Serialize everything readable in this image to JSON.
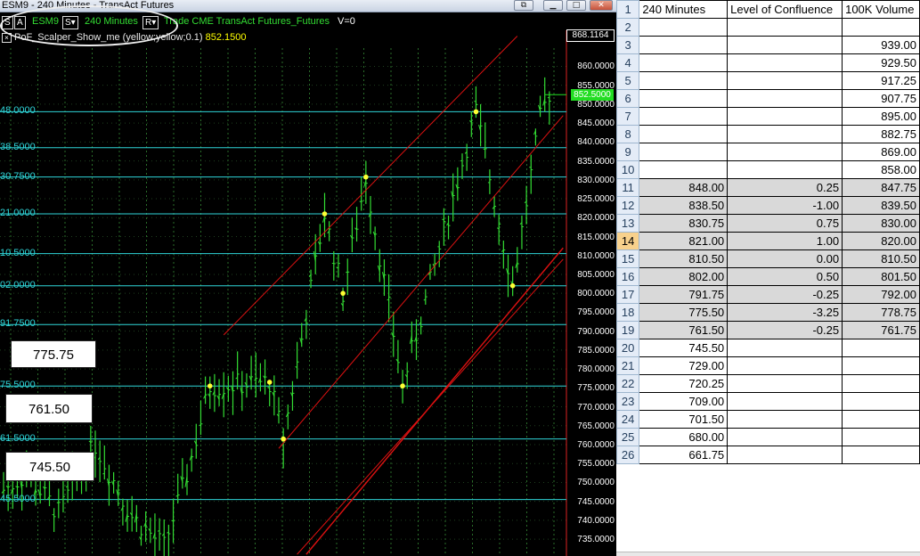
{
  "window": {
    "title": "ESM9 - 240 Minutes - TransAct Futures",
    "buttons": {
      "restore": "⧉",
      "minimize": "▁",
      "maximize": "□",
      "close": "✕"
    }
  },
  "toolbar": {
    "s_box": "S",
    "a_box": "A",
    "symbol": "ESM9",
    "s_dropdown": "S▾",
    "interval": "240 Minutes",
    "r_dropdown": "R▾",
    "info": "Trade CME TransAct Futures_Futures",
    "volume": "V=0"
  },
  "study": {
    "icon": "×",
    "label": "PoF_Scalper_Show_me (yellow;yellow;0.1)",
    "value": "852.1500"
  },
  "price_axis": {
    "top_box": "868.1164",
    "current_box": "852.5000",
    "labels": [
      "860.0000",
      "855.0000",
      "850.0000",
      "845.0000",
      "840.0000",
      "835.0000",
      "830.0000",
      "825.0000",
      "820.0000",
      "815.0000",
      "810.0000",
      "805.0000",
      "800.0000",
      "795.0000",
      "790.0000",
      "785.0000",
      "780.0000",
      "775.0000",
      "770.0000",
      "765.0000",
      "760.0000",
      "755.0000",
      "750.0000",
      "745.0000",
      "740.0000",
      "735.0000"
    ]
  },
  "levels": [
    {
      "label": "48.0000",
      "price": 848.0
    },
    {
      "label": "38.5000",
      "price": 838.5
    },
    {
      "label": "30.7500",
      "price": 830.75
    },
    {
      "label": "21.0000",
      "price": 821.0
    },
    {
      "label": "10.5000",
      "price": 810.5
    },
    {
      "label": "02.0000",
      "price": 802.0
    },
    {
      "label": "91.7500",
      "price": 791.75
    },
    {
      "label": "75.5000",
      "price": 775.5
    },
    {
      "label": "61.5000",
      "price": 761.5
    },
    {
      "label": "45.5000",
      "price": 745.5
    }
  ],
  "callouts": [
    "775.75",
    "761.50",
    "745.50"
  ],
  "colors": {
    "background": "#000000",
    "bars": "#33dd33",
    "levels": "#2fd5d8",
    "channels": "#dd1111",
    "grid": "#2a6e2a",
    "pivots": "#ffff33",
    "current_price": "#22dd22"
  },
  "chart_data": {
    "type": "bar",
    "y_range": [
      731.5,
      868.1164
    ],
    "current_price": 852.5,
    "pivots": [
      {
        "bar": 45,
        "price": 775.5
      },
      {
        "bar": 58,
        "price": 776.5
      },
      {
        "bar": 61,
        "price": 761.5
      },
      {
        "bar": 70,
        "price": 821.0
      },
      {
        "bar": 74,
        "price": 800.0
      },
      {
        "bar": 79,
        "price": 830.75
      },
      {
        "bar": 87,
        "price": 775.5
      },
      {
        "bar": 103,
        "price": 848.0
      },
      {
        "bar": 111,
        "price": 802.0
      }
    ]
  },
  "sheet": {
    "headers": [
      "240 Minutes",
      "Level of Confluence",
      "100K Volume"
    ],
    "active_row": 14,
    "rows": [
      {
        "n": "2",
        "a": "",
        "b": "",
        "c": "",
        "gray": false,
        "bord": true
      },
      {
        "n": "3",
        "a": "",
        "b": "",
        "c": "939.00",
        "gray": false,
        "bord": true
      },
      {
        "n": "4",
        "a": "",
        "b": "",
        "c": "929.50",
        "gray": false,
        "bord": true
      },
      {
        "n": "5",
        "a": "",
        "b": "",
        "c": "917.25",
        "gray": false,
        "bord": true
      },
      {
        "n": "6",
        "a": "",
        "b": "",
        "c": "907.75",
        "gray": false,
        "bord": true
      },
      {
        "n": "7",
        "a": "",
        "b": "",
        "c": "895.00",
        "gray": false,
        "bord": true
      },
      {
        "n": "8",
        "a": "",
        "b": "",
        "c": "882.75",
        "gray": false,
        "bord": true
      },
      {
        "n": "9",
        "a": "",
        "b": "",
        "c": "869.00",
        "gray": false,
        "bord": true
      },
      {
        "n": "10",
        "a": "",
        "b": "",
        "c": "858.00",
        "gray": false,
        "bord": true
      },
      {
        "n": "11",
        "a": "848.00",
        "b": "0.25",
        "c": "847.75",
        "gray": true,
        "bord": true
      },
      {
        "n": "12",
        "a": "838.50",
        "b": "-1.00",
        "c": "839.50",
        "gray": true,
        "bord": true
      },
      {
        "n": "13",
        "a": "830.75",
        "b": "0.75",
        "c": "830.00",
        "gray": true,
        "bord": true
      },
      {
        "n": "14",
        "a": "821.00",
        "b": "1.00",
        "c": "820.00",
        "gray": true,
        "bord": true
      },
      {
        "n": "15",
        "a": "810.50",
        "b": "0.00",
        "c": "810.50",
        "gray": true,
        "bord": true
      },
      {
        "n": "16",
        "a": "802.00",
        "b": "0.50",
        "c": "801.50",
        "gray": true,
        "bord": true
      },
      {
        "n": "17",
        "a": "791.75",
        "b": "-0.25",
        "c": "792.00",
        "gray": true,
        "bord": true
      },
      {
        "n": "18",
        "a": "775.50",
        "b": "-3.25",
        "c": "778.75",
        "gray": true,
        "bord": true
      },
      {
        "n": "19",
        "a": "761.50",
        "b": "-0.25",
        "c": "761.75",
        "gray": true,
        "bord": true
      },
      {
        "n": "20",
        "a": "745.50",
        "b": "",
        "c": "",
        "gray": false,
        "bord": true
      },
      {
        "n": "21",
        "a": "729.00",
        "b": "",
        "c": "",
        "gray": false,
        "bord": true
      },
      {
        "n": "22",
        "a": "720.25",
        "b": "",
        "c": "",
        "gray": false,
        "bord": true
      },
      {
        "n": "23",
        "a": "709.00",
        "b": "",
        "c": "",
        "gray": false,
        "bord": true
      },
      {
        "n": "24",
        "a": "701.50",
        "b": "",
        "c": "",
        "gray": false,
        "bord": true
      },
      {
        "n": "25",
        "a": "680.00",
        "b": "",
        "c": "",
        "gray": false,
        "bord": true
      },
      {
        "n": "26",
        "a": "661.75",
        "b": "",
        "c": "",
        "gray": false,
        "bord": true
      }
    ]
  }
}
